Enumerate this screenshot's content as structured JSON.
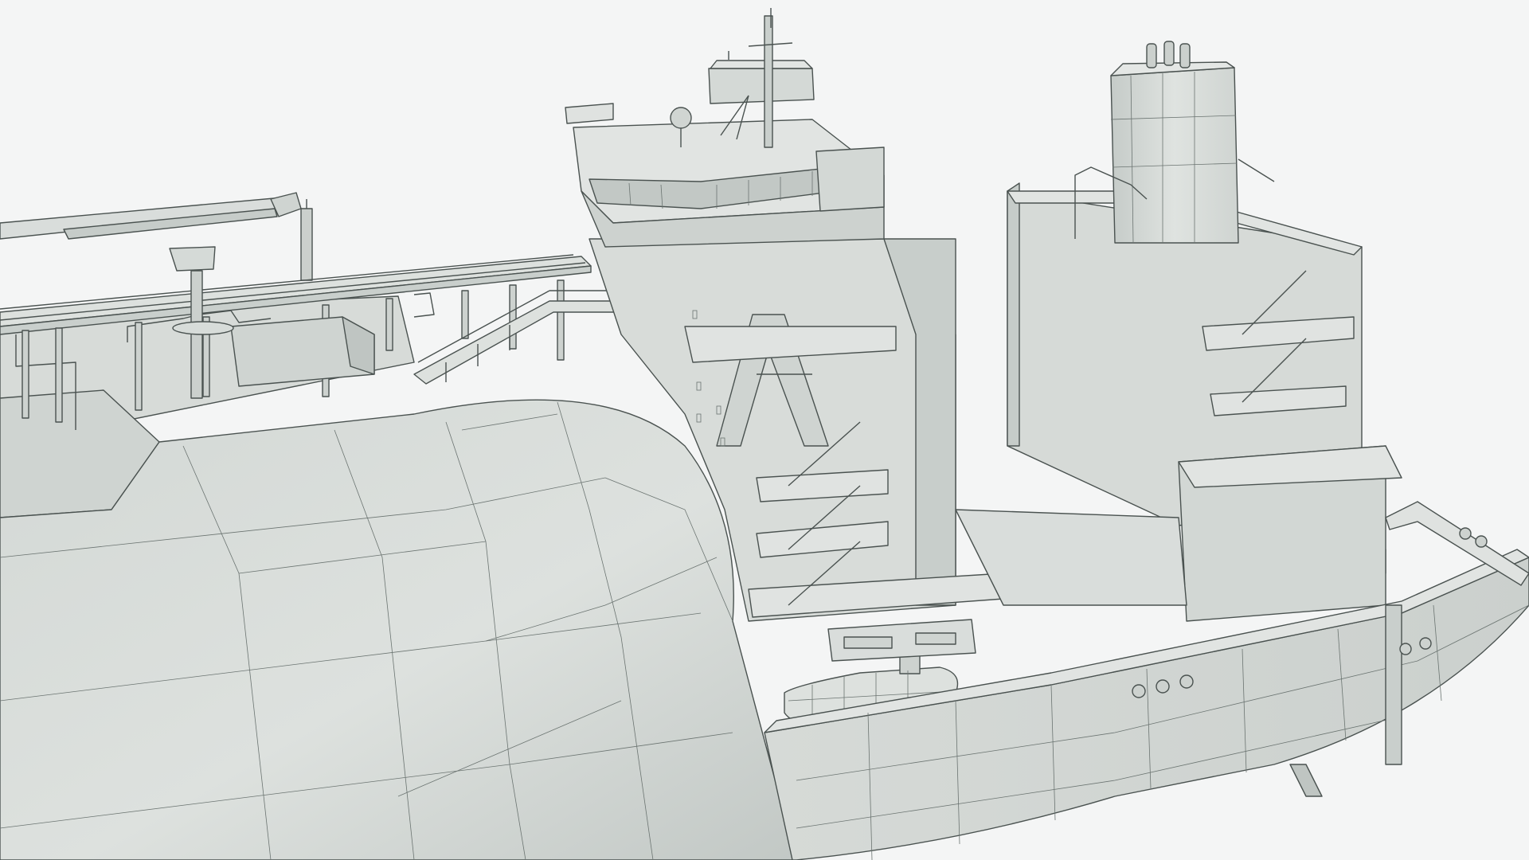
{
  "scene": {
    "subject": "ship-render",
    "colors": {
      "background": "#f4f5f5",
      "hull_light": "#dfe3e0",
      "hull_mid": "#cdd2cf",
      "hull_dark": "#b4bab7",
      "edge": "#4a5250"
    }
  }
}
